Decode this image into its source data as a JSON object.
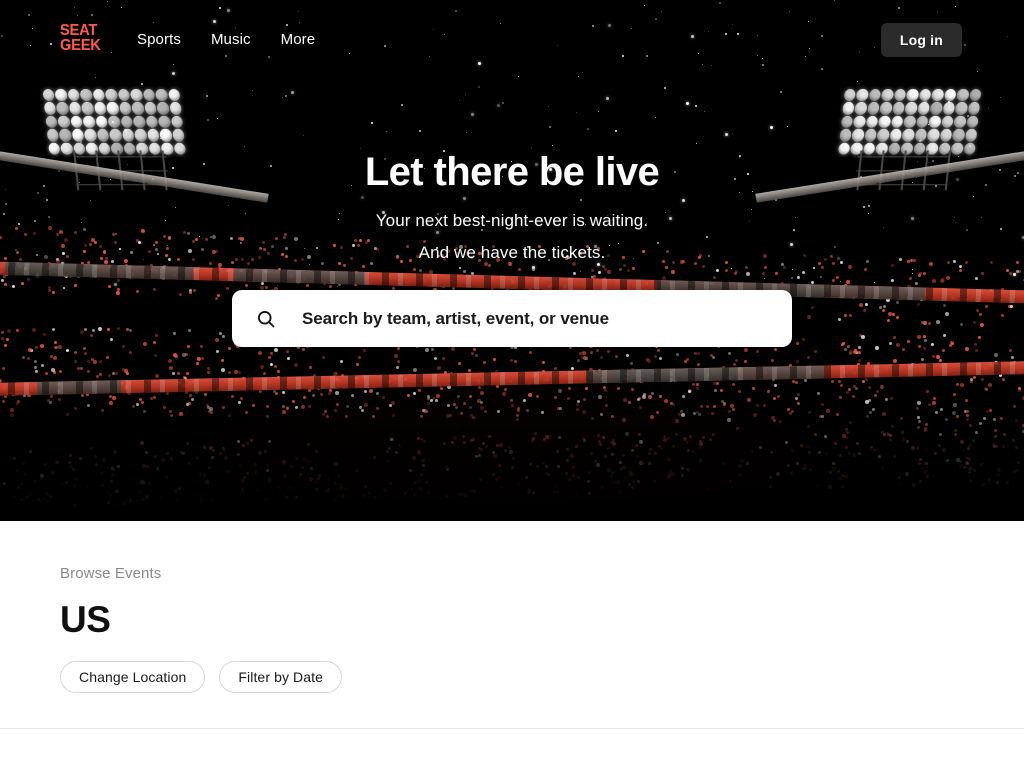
{
  "nav": {
    "logo": {
      "line1": "SEAT",
      "line2": "GEEK",
      "color": "#ff5b49"
    },
    "links": [
      {
        "label": "Sports"
      },
      {
        "label": "Music"
      },
      {
        "label": "More"
      }
    ],
    "login_label": "Log in"
  },
  "hero": {
    "title": "Let there be live",
    "subtitle_line1": "Your next best-night-ever is waiting.",
    "subtitle_line2": "And we have the tickets.",
    "search": {
      "placeholder": "Search by team, artist, event, or venue",
      "value": "",
      "icon": "search-icon"
    },
    "background": {
      "base_color": "#000000",
      "crowd_accent": "#e8553f",
      "light_color": "#ffffff"
    }
  },
  "browse": {
    "eyebrow": "Browse Events",
    "location": "US",
    "chips": [
      {
        "label": "Change Location"
      },
      {
        "label": "Filter by Date"
      }
    ]
  }
}
